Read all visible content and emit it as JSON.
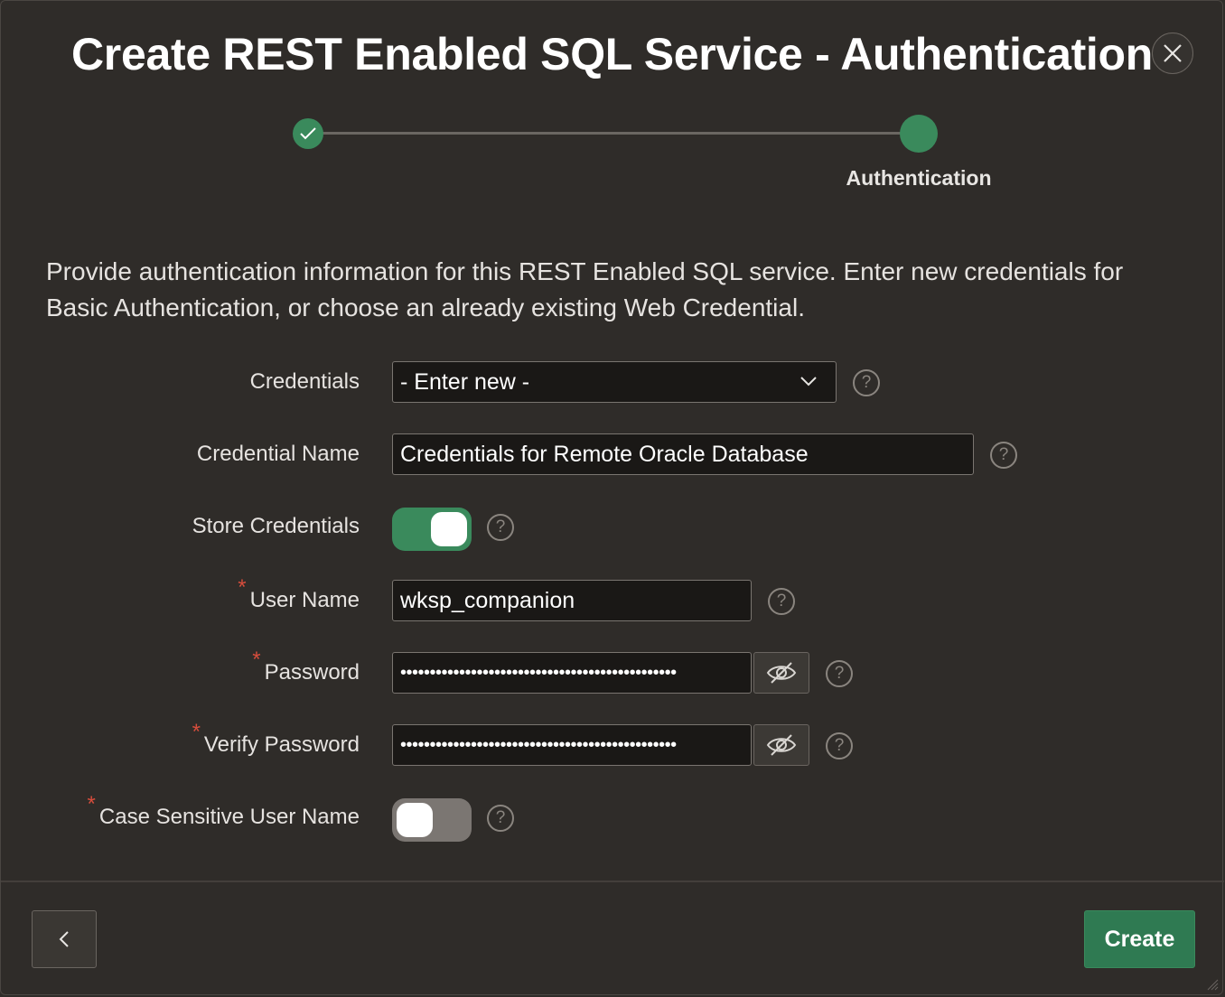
{
  "dialog": {
    "title": "Create REST Enabled SQL Service - Authentication",
    "close_icon": "close-icon"
  },
  "stepper": {
    "steps": [
      {
        "state": "completed",
        "icon": "check-icon",
        "label": ""
      },
      {
        "state": "current",
        "label": "Authentication"
      }
    ]
  },
  "description": "Provide authentication information for this REST Enabled SQL service. Enter new credentials for Basic Authentication, or choose an already existing Web Credential.",
  "form": {
    "credentials": {
      "label": "Credentials",
      "value": "- Enter new -"
    },
    "credential_name": {
      "label": "Credential Name",
      "value": "Credentials for Remote Oracle Database"
    },
    "store_credentials": {
      "label": "Store Credentials",
      "checked": true
    },
    "user_name": {
      "label": "User Name",
      "required_mark": "*",
      "value": "wksp_companion"
    },
    "password": {
      "label": "Password",
      "required_mark": "*",
      "value": "•••••••••••••••••••••••••••••••••••••••••••••••"
    },
    "verify_password": {
      "label": "Verify Password",
      "required_mark": "*",
      "value": "•••••••••••••••••••••••••••••••••••••••••••••••"
    },
    "case_sensitive": {
      "label": "Case Sensitive User Name",
      "required_mark": "*",
      "checked": false
    },
    "help_glyph": "?"
  },
  "footer": {
    "back_icon": "chevron-left-icon",
    "create_label": "Create"
  },
  "colors": {
    "background": "#2f2c29",
    "accent_green": "#3a8a5c",
    "required_red": "#d64d3c"
  }
}
